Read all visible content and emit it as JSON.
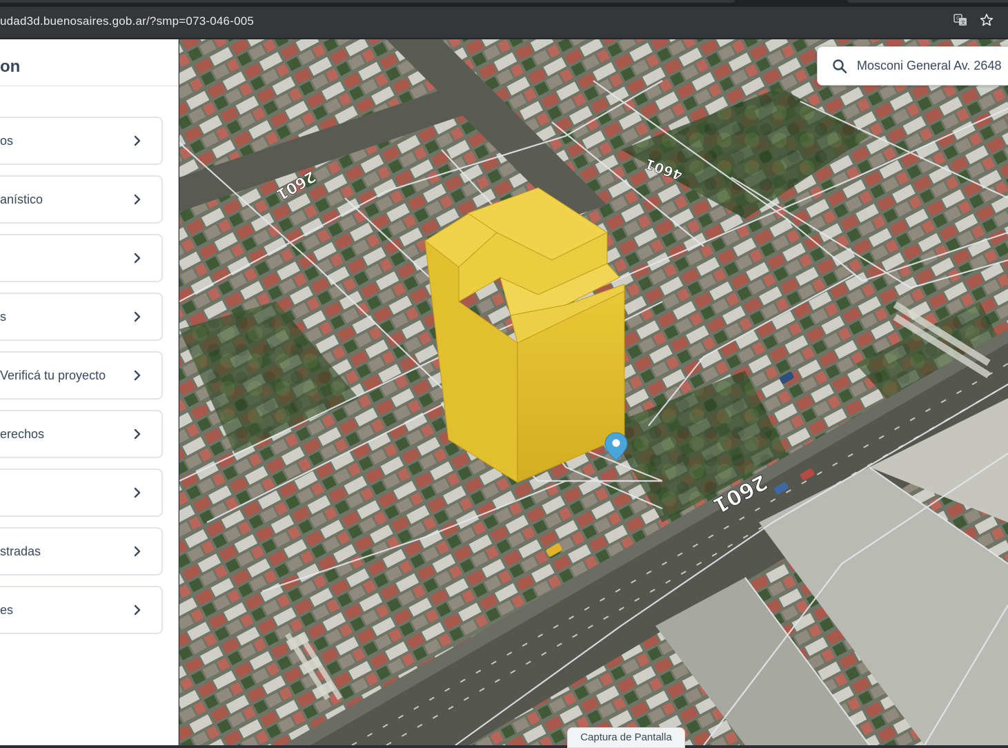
{
  "browser": {
    "url": "udad3d.buenosaires.gob.ar/?smp=073-046-005",
    "icons": [
      "translate-icon",
      "star-icon"
    ]
  },
  "sidebar": {
    "title": "on",
    "items": [
      {
        "label": "os"
      },
      {
        "label": "anístico"
      },
      {
        "label": ""
      },
      {
        "label": "s"
      },
      {
        "label": "Verificá tu proyecto"
      },
      {
        "label": "erechos"
      },
      {
        "label": ""
      },
      {
        "label": "stradas"
      },
      {
        "label": "es"
      }
    ]
  },
  "map": {
    "street_numbers": [
      "2601",
      "4601",
      "2601"
    ]
  },
  "search": {
    "value": "Mosconi General Av. 2648"
  },
  "capture_button": {
    "label": "Captura de Pantalla"
  },
  "colors": {
    "building": "#e3bf2b",
    "marker": "#4aa6d8",
    "sidebar_text": "#38485c"
  }
}
